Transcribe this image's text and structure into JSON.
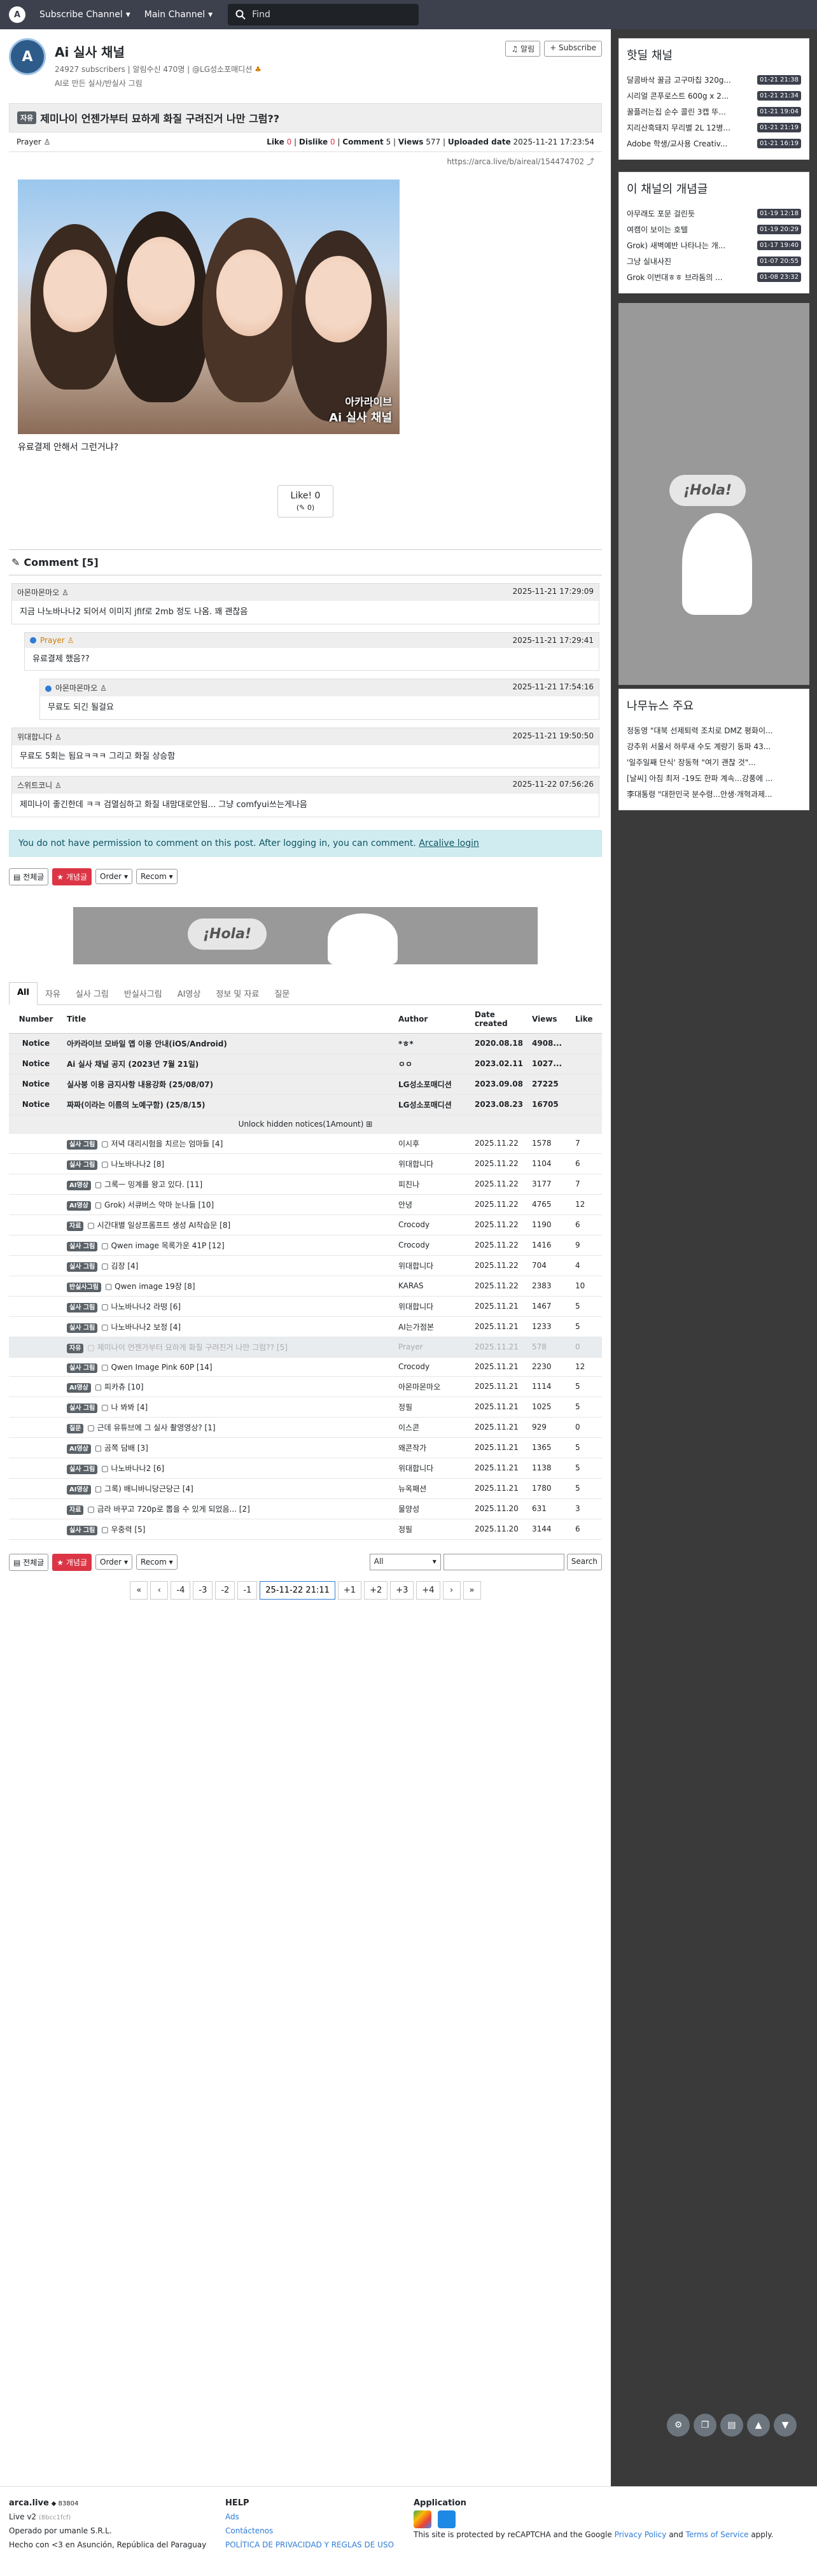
{
  "nav": {
    "logo": "A",
    "subscribe_channel": "Subscribe Channel",
    "main_channel": "Main Channel",
    "search_placeholder": "Find"
  },
  "channel": {
    "name": "Ai 실사 채널",
    "subscribers": "24927 subscribers",
    "alarm": "알림수신 470명",
    "owner": "@LG성소포매디션",
    "desc": "AI로 만든 실사/반실사 그림",
    "alarm_btn": "알림",
    "subscribe_btn": "Subscribe"
  },
  "article": {
    "category": "자유",
    "title": "제미나이 언젠가부터 묘하게 화질 구려진거 나만 그럼??",
    "author": "Prayer",
    "like_label": "Like",
    "like": "0",
    "dislike_label": "Dislike",
    "dislike": "0",
    "comment_label": "Comment",
    "comment": "5",
    "views_label": "Views",
    "views": "577",
    "uploaded_label": "Uploaded date",
    "uploaded": "2025-11-21 17:23:54",
    "url": "https://arca.live/b/aireal/154474702",
    "watermark1": "아카라이브",
    "watermark2": "Ai 실사 채널",
    "caption": "유료결제 안해서 그런거냐?",
    "like_btn": "Like!",
    "like_btn_count": "0",
    "like_btn_sub": "0"
  },
  "comments": {
    "header": "Comment [5]",
    "items": [
      {
        "user": "아몬마몬마오",
        "time": "2025-11-21 17:29:09",
        "text": "지금 나노바나나2 되어서 이미지 jfif로 2mb 정도 나옴. 꽤 괜찮음"
      },
      {
        "user": "Prayer",
        "time": "2025-11-21 17:29:41",
        "text": "유료결제 했음??"
      },
      {
        "user": "아몬마몬마오",
        "time": "2025-11-21 17:54:16",
        "text": "무료도 되긴 될걸요"
      },
      {
        "user": "위대합니다",
        "time": "2025-11-21 19:50:50",
        "text": "무료도 5회는 됨요ㅋㅋㅋ 그리고 화질 상승함"
      },
      {
        "user": "스위트코니",
        "time": "2025-11-22 07:56:26",
        "text": "제미나이 좋긴한데 ㅋㅋ 검열심하고 화질 내맘대로안됨... 그냥 comfyui쓰는게나음"
      }
    ]
  },
  "permission": {
    "text": "You do not have permission to comment on this post. After logging in, you can comment.",
    "link": "Arcalive login"
  },
  "toolbar": {
    "all": "전체글",
    "best": "개념글",
    "order": "Order",
    "recom": "Recom"
  },
  "banner": {
    "hola": "¡Hola!"
  },
  "tabs": [
    "All",
    "자유",
    "실사 그림",
    "반실사그림",
    "AI영상",
    "정보 및 자료",
    "질문"
  ],
  "table": {
    "headers": [
      "Number",
      "Title",
      "Author",
      "Date created",
      "Views",
      "Like"
    ],
    "notices": [
      {
        "n": "Notice",
        "title": "아카라이브 모바일 앱 이용 안내(iOS/Android)",
        "author": "*ㅎ*",
        "date": "2020.08.18",
        "views": "4908...",
        "like": ""
      },
      {
        "n": "Notice",
        "title": "Ai 실사 채널 공지 (2023년 7월 21일)",
        "author": "ㅇㅇ",
        "date": "2023.02.11",
        "views": "1027...",
        "like": ""
      },
      {
        "n": "Notice",
        "title": "실사붕 이용 금지사항 내용강화 (25/08/07)",
        "author": "LG성소포매디션",
        "date": "2023.09.08",
        "views": "27225",
        "like": ""
      },
      {
        "n": "Notice",
        "title": "짜짜(이라는 이름의 노예구함) (25/8/15)",
        "author": "LG성소포매디션",
        "date": "2023.08.23",
        "views": "16705",
        "like": ""
      }
    ],
    "unlock": "Unlock hidden notices(1Amount)",
    "rows": [
      {
        "cat": "실사 그림",
        "title": "저녁 대리시험을 치르는 엄마들 [4]",
        "author": "이시후",
        "date": "2025.11.22",
        "views": "1578",
        "like": "7"
      },
      {
        "cat": "실사 그림",
        "title": "나노바나나2 [8]",
        "author": "위대합니다",
        "date": "2025.11.22",
        "views": "1104",
        "like": "6"
      },
      {
        "cat": "AI영상",
        "title": "그록ㅡ 밍계를 왕고 있다. [11]",
        "author": "피친나",
        "date": "2025.11.22",
        "views": "3177",
        "like": "7"
      },
      {
        "cat": "AI영상",
        "title": "Grok) 서큐버스 악마 눈나들 [10]",
        "author": "안녕",
        "date": "2025.11.22",
        "views": "4765",
        "like": "12"
      },
      {
        "cat": "자료",
        "title": "시간대별 일상프롬프트 생성 AI작습문 [8]",
        "author": "Crocody",
        "date": "2025.11.22",
        "views": "1190",
        "like": "6"
      },
      {
        "cat": "실사 그림",
        "title": "Qwen image 목록가운 41P [12]",
        "author": "Crocody",
        "date": "2025.11.22",
        "views": "1416",
        "like": "9"
      },
      {
        "cat": "실사 그림",
        "title": "김장 [4]",
        "author": "위대합니다",
        "date": "2025.11.22",
        "views": "704",
        "like": "4"
      },
      {
        "cat": "반실사그림",
        "title": "Qwen image 19장 [8]",
        "author": "KARAS",
        "date": "2025.11.22",
        "views": "2383",
        "like": "10"
      },
      {
        "cat": "실사 그림",
        "title": "나노바나나2 라떵 [6]",
        "author": "위대합니다",
        "date": "2025.11.21",
        "views": "1467",
        "like": "5"
      },
      {
        "cat": "실사 그림",
        "title": "나노바나나2 보정 [4]",
        "author": "AI는가점본",
        "date": "2025.11.21",
        "views": "1233",
        "like": "5"
      },
      {
        "cat": "자유",
        "title": "제미나이 언젠가부터 묘하게 화질 구려진거 나만 그럼?? [5]",
        "author": "Prayer",
        "date": "2025.11.21",
        "views": "578",
        "like": "0"
      },
      {
        "cat": "실사 그림",
        "title": "Qwen Image Pink 60P [14]",
        "author": "Crocody",
        "date": "2025.11.21",
        "views": "2230",
        "like": "12"
      },
      {
        "cat": "AI영상",
        "title": "피카츄 [10]",
        "author": "아몬마몬마오",
        "date": "2025.11.21",
        "views": "1114",
        "like": "5"
      },
      {
        "cat": "실사 그림",
        "title": "나 봐봐 [4]",
        "author": "정필",
        "date": "2025.11.21",
        "views": "1025",
        "like": "5"
      },
      {
        "cat": "질문",
        "title": "근데 유튜브에 그 실사 촬영영상? [1]",
        "author": "이스콘",
        "date": "2025.11.21",
        "views": "929",
        "like": "0"
      },
      {
        "cat": "AI영상",
        "title": "곰쪽 담배 [3]",
        "author": "왜콘작가",
        "date": "2025.11.21",
        "views": "1365",
        "like": "5"
      },
      {
        "cat": "실사 그림",
        "title": "나노바나나2 [6]",
        "author": "위대합니다",
        "date": "2025.11.21",
        "views": "1138",
        "like": "5"
      },
      {
        "cat": "AI영상",
        "title": "그록) 배니바니당근당근 [4]",
        "author": "뉴옥패션",
        "date": "2025.11.21",
        "views": "1780",
        "like": "5"
      },
      {
        "cat": "자료",
        "title": "금라 바꾸고 720p로 뽑을 수 있게 되었음... [2]",
        "author": "물양성",
        "date": "2025.11.20",
        "views": "631",
        "like": "3"
      },
      {
        "cat": "실사 그림",
        "title": "우중력 [5]",
        "author": "정필",
        "date": "2025.11.20",
        "views": "3144",
        "like": "6"
      }
    ]
  },
  "bottom": {
    "select": "All",
    "search_btn": "Search"
  },
  "pager": [
    "«",
    "‹",
    "-4",
    "-3",
    "-2",
    "-1",
    "25-11-22 21:11",
    "+1",
    "+2",
    "+3",
    "+4",
    "›",
    "»"
  ],
  "side": {
    "hot": {
      "title": "핫딜 채널",
      "items": [
        {
          "t": "달콤바삭 꿀금 고구마칩 320g...",
          "tm": "01-21 21:38"
        },
        {
          "t": "시리얼 콘푸로스트 600g x 2...",
          "tm": "01-21 21:34"
        },
        {
          "t": "꿀플러는집 순수 콜린 3캡 뚜...",
          "tm": "01-21 19:04"
        },
        {
          "t": "지리산흑돼지 무리별 2L 12병...",
          "tm": "01-21 21:19"
        },
        {
          "t": "Adobe 학생/교사용 Creativ...",
          "tm": "01-21 16:19"
        }
      ]
    },
    "best": {
      "title": "이 채널의 개념글",
      "items": [
        {
          "t": "아무래도 포문 걸린듯",
          "tm": "01-19 12:18"
        },
        {
          "t": "여캠이 보이는 호텔",
          "tm": "01-19 20:29"
        },
        {
          "t": "Grok) 새벽예반 나타나는 개...",
          "tm": "01-17 19:40"
        },
        {
          "t": "그냥 실내사진",
          "tm": "01-07 20:55"
        },
        {
          "t": "Grok 이번대ㅎㅎ 브라돔의 ...",
          "tm": "01-08 23:32"
        }
      ]
    },
    "ad_hola": "¡Hola!",
    "news": {
      "title": "나무뉴스 주요",
      "items": [
        "정동영 \"대북 선제퇴력 조치로 DMZ 평화이...",
        "강추위 서울서 하루새 수도 계량기 동파 43...",
        "'일주일째 단식' 장동혁 \"여기 괜찮 것\"...",
        "[날씨] 아침 최저 -19도 한파 계속...강풍에 ...",
        "李대통령 \"대한민국 분수령...안생·개혁과제..."
      ]
    }
  },
  "footer": {
    "brand": "arca.live",
    "count": "◆ 83804",
    "ver": "Live v2",
    "ver_sub": "(8bcc1fcf)",
    "op": "Operado por umanle S.R.L.",
    "made": "Hecho con <3 en Asunción, República del Paraguay",
    "help": "HELP",
    "ads": "Ads",
    "contact": "Contáctenos",
    "policy": "POLÍTICA DE PRIVACIDAD Y REGLAS DE USO",
    "app": "Application",
    "recaptcha1": "This site is protected by reCAPTCHA and the Google",
    "privacy": "Privacy Policy",
    "and": "and",
    "terms": "Terms of Service",
    "apply": "apply."
  }
}
